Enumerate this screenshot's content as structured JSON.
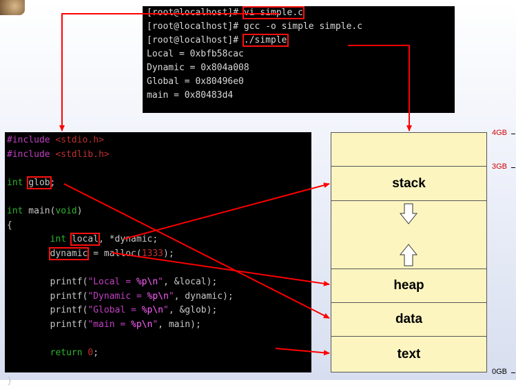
{
  "terminal": {
    "lines": [
      {
        "prompt": "[root@localhost]# ",
        "cmd": "vi simple.c"
      },
      {
        "prompt": "[root@localhost]# ",
        "cmd": "gcc -o simple simple.c"
      },
      {
        "prompt": "[root@localhost]# ",
        "cmd": "./simple"
      }
    ],
    "output": [
      "Local = 0xbfb58cac",
      "Dynamic = 0x804a008",
      "Global = 0x80496e0",
      "main = 0x80483d4"
    ]
  },
  "code": {
    "inc1_kw": "#include",
    "inc1_file": " <stdio.h>",
    "inc2_kw": "#include",
    "inc2_file": " <stdlib.h>",
    "glob_type": "int",
    "glob_name": "glob",
    "glob_end": ";",
    "main_type": "int",
    "main_sig": " main(",
    "main_void": "void",
    "main_close": ")",
    "open_brace": "{",
    "local_indent": "        ",
    "local_type": "int",
    "local_name": "local",
    "local_rest": ", *dynamic;",
    "dyn_indent": "        ",
    "dyn_name": "dynamic",
    "dyn_rest": " = malloc(",
    "dyn_num": "1333",
    "dyn_end": ");",
    "pf1_a": "        printf(",
    "pf1_s": "\"Local = ",
    "pf1_e": "%p\\n",
    "pf1_q": "\"",
    "pf1_b": ", &local);",
    "pf2_a": "        printf(",
    "pf2_s": "\"Dynamic = ",
    "pf2_e": "%p\\n",
    "pf2_q": "\"",
    "pf2_b": ", dynamic);",
    "pf3_a": "        printf(",
    "pf3_s": "\"Global = ",
    "pf3_e": "%p\\n",
    "pf3_q": "\"",
    "pf3_b": ", &glob);",
    "pf4_a": "        printf(",
    "pf4_s": "\"main = ",
    "pf4_e": "%p\\n",
    "pf4_q": "\"",
    "pf4_b": ", main);",
    "ret_indent": "        ",
    "ret_kw": "return",
    "ret_sp": " ",
    "ret_num": "0",
    "ret_end": ";",
    "close_brace": "}"
  },
  "memory": {
    "segments": {
      "stack": "stack",
      "heap": "heap",
      "data": "data",
      "text": "text"
    },
    "addresses": {
      "top": "4GB",
      "kernel": "3GB",
      "bottom": "0GB"
    },
    "fill_color": "#fdf5c0",
    "arrow_color": "#ff0000"
  }
}
